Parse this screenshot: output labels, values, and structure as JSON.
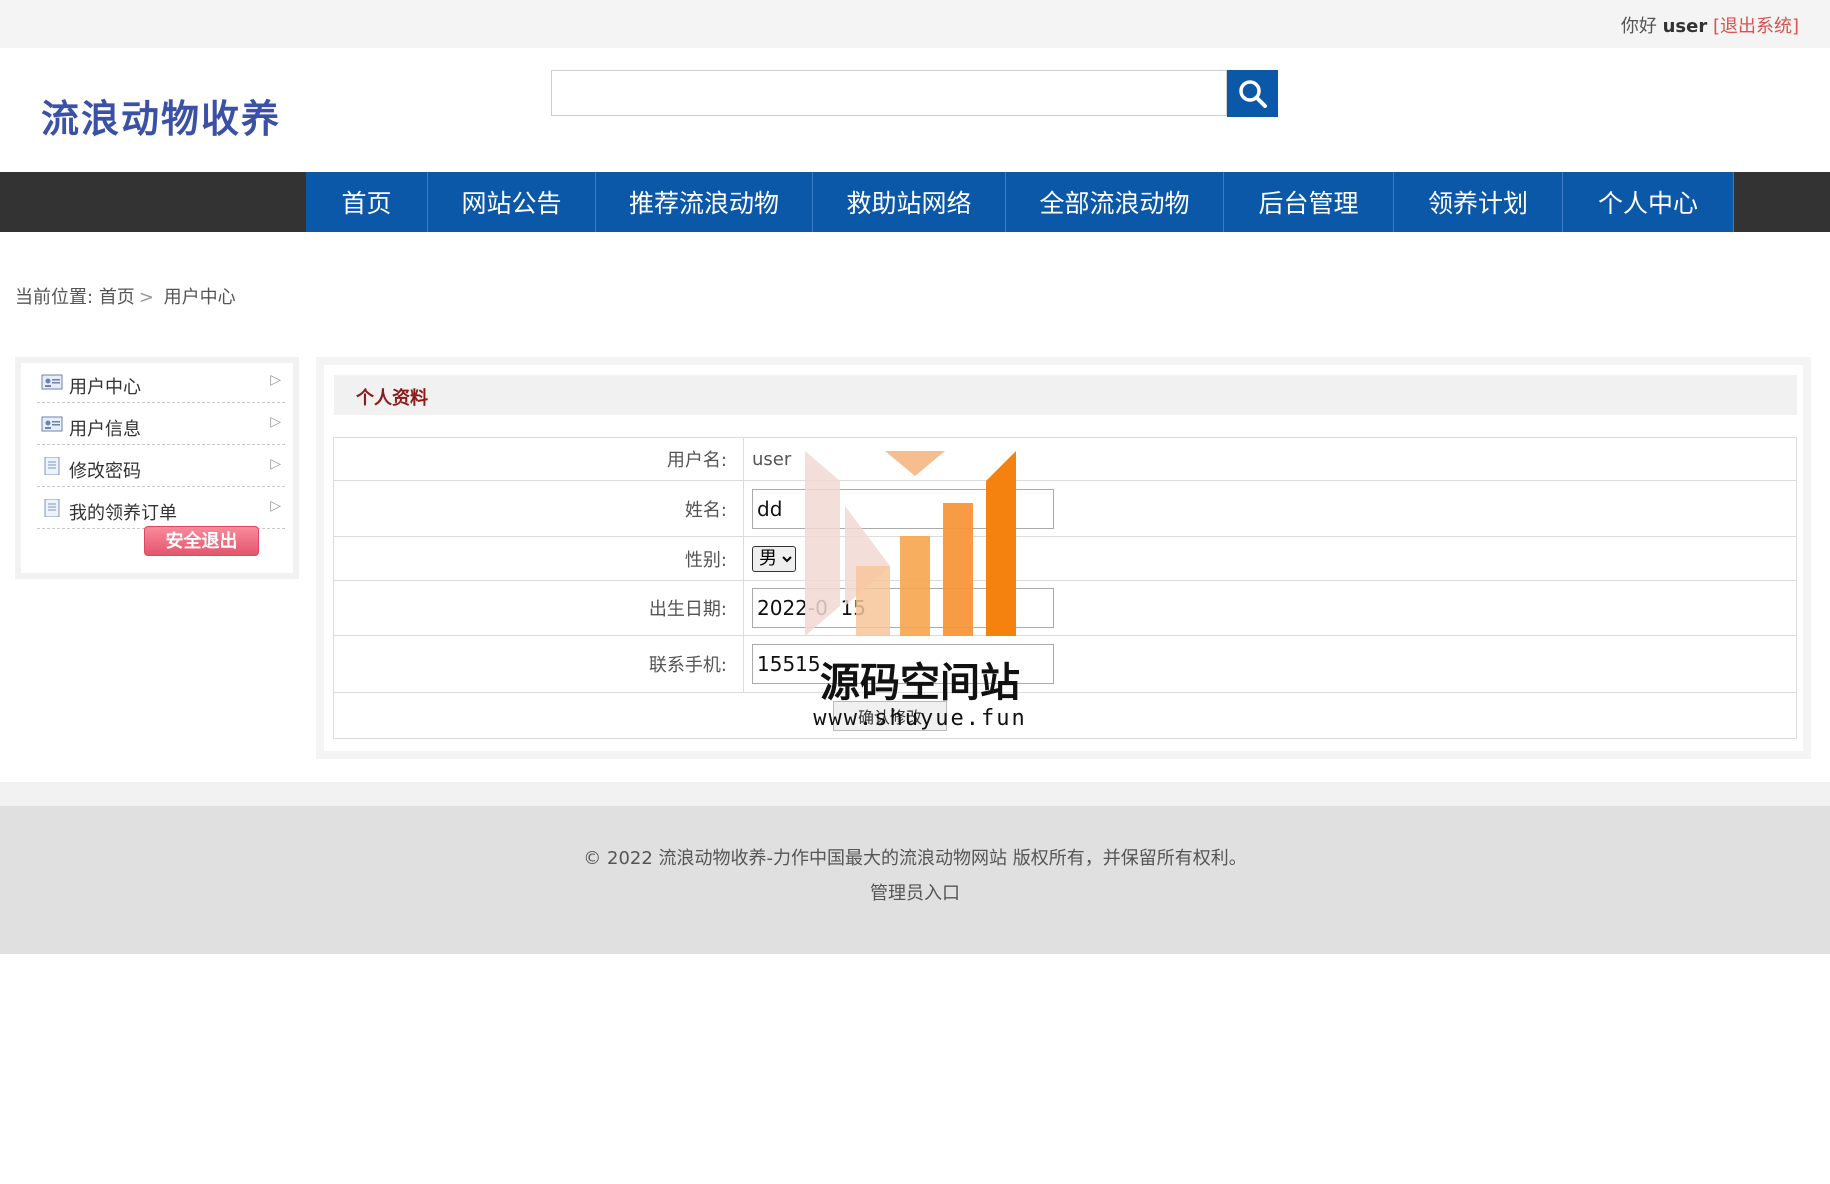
{
  "topbar": {
    "greeting": "你好",
    "username": "user",
    "logout": "[退出系统]"
  },
  "header": {
    "logo": "流浪动物收养",
    "search_placeholder": "",
    "search_icon": "search-icon"
  },
  "nav": [
    {
      "label": "首页"
    },
    {
      "label": "网站公告"
    },
    {
      "label": "推荐流浪动物"
    },
    {
      "label": "救助站网络"
    },
    {
      "label": "全部流浪动物"
    },
    {
      "label": "后台管理"
    },
    {
      "label": "领养计划"
    },
    {
      "label": "个人中心"
    }
  ],
  "breadcrumb": {
    "prefix": "当前位置:",
    "home": "首页",
    "current": "用户中心"
  },
  "sidebar": {
    "items": [
      {
        "label": "用户中心",
        "icon": "id-card-icon"
      },
      {
        "label": "用户信息",
        "icon": "id-card-icon"
      },
      {
        "label": "修改密码",
        "icon": "document-icon"
      },
      {
        "label": "我的领养订单",
        "icon": "document-icon"
      }
    ],
    "exit_button": "安全退出"
  },
  "profile": {
    "title": "个人资料",
    "username_label": "用户名:",
    "username_value": "user",
    "name_label": "姓名:",
    "name_value": "dd",
    "gender_label": "性别:",
    "gender_value": "男",
    "birth_label": "出生日期:",
    "birth_value": "2022-0  15",
    "phone_label": "联系手机:",
    "phone_value": "15515",
    "submit_label": "确认修改"
  },
  "footer": {
    "copyright": "© 2022 流浪动物收养-力作中国最大的流浪动物网站 版权所有，并保留所有权利。",
    "admin_link": "管理员入口"
  },
  "watermark": {
    "title": "源码空间站",
    "url": "www.shuyue.fun"
  },
  "colors": {
    "nav_blue": "#0b57a8",
    "nav_bar": "#333333",
    "logo": "#3b51a5",
    "title_red": "#8b1a1a",
    "logout": "#d9534f"
  }
}
